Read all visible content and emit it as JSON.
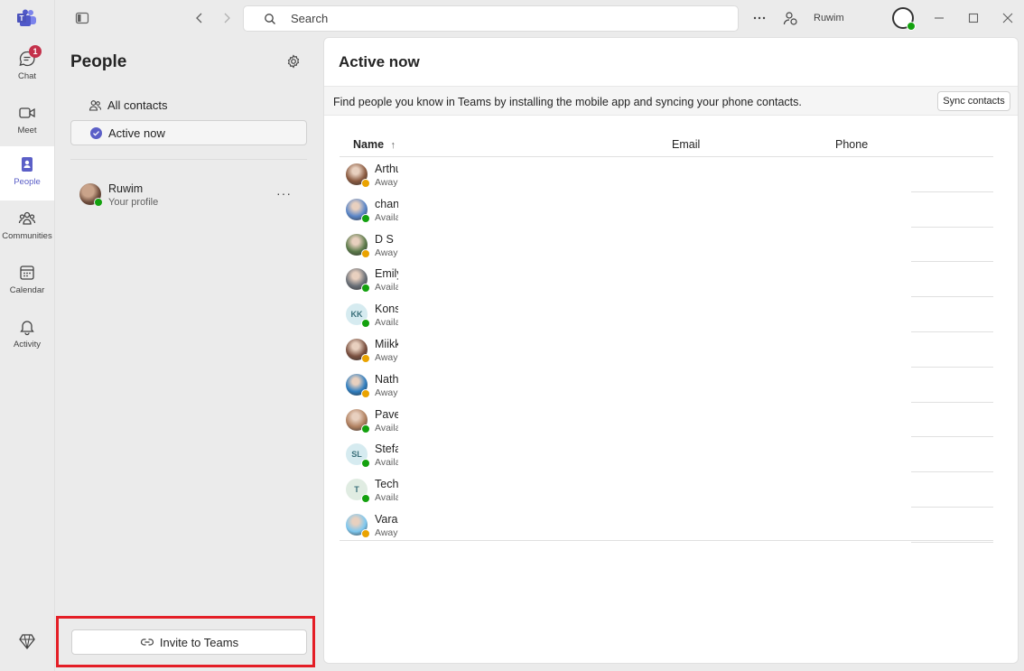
{
  "rail": {
    "items": [
      {
        "label": "Chat",
        "badge": "1"
      },
      {
        "label": "Meet"
      },
      {
        "label": "People"
      },
      {
        "label": "Communities"
      },
      {
        "label": "Calendar"
      },
      {
        "label": "Activity"
      }
    ]
  },
  "titlebar": {
    "search_placeholder": "Search",
    "user_name": "Ruwim"
  },
  "people_panel": {
    "title": "People",
    "nav": [
      "All contacts",
      "Active now"
    ],
    "profile": {
      "name": "Ruwim",
      "subtitle": "Your profile"
    },
    "invite_label": "Invite to Teams"
  },
  "main": {
    "title": "Active now",
    "banner_text": "Find people you know in Teams by installing the mobile app and syncing your phone contacts.",
    "sync_label": "Sync contacts",
    "columns": {
      "name": "Name",
      "name_sort": "↑",
      "email": "Email",
      "phone": "Phone"
    },
    "contacts": [
      {
        "name": "Arthu",
        "status": "Away",
        "avatar": "photo",
        "color": "#8a5a40",
        "state": "away"
      },
      {
        "name": "chan",
        "status": "Availa",
        "avatar": "photo",
        "color": "#5a86c8",
        "state": "available"
      },
      {
        "name": "D S",
        "status": "Away",
        "avatar": "photo",
        "color": "#5b7a4a",
        "state": "away"
      },
      {
        "name": "Emily",
        "status": "Availa",
        "avatar": "photo",
        "color": "#6a7078",
        "state": "available"
      },
      {
        "name": "Kons",
        "status": "Availa",
        "avatar": "KK",
        "color": "#d6ebf0",
        "state": "available"
      },
      {
        "name": "Miikk",
        "status": "Away",
        "avatar": "photo",
        "color": "#7a5040",
        "state": "away"
      },
      {
        "name": "Nath",
        "status": "Away",
        "avatar": "photo",
        "color": "#2f7ec0",
        "state": "away"
      },
      {
        "name": "Pavel",
        "status": "Availa",
        "avatar": "photo",
        "color": "#b08060",
        "state": "available"
      },
      {
        "name": "Stefa",
        "status": "Availa",
        "avatar": "SL",
        "color": "#d6ebf0",
        "state": "available"
      },
      {
        "name": "Techt",
        "status": "Availa",
        "avatar": "T",
        "color": "#e0ece2",
        "state": "available"
      },
      {
        "name": "Varar",
        "status": "Away",
        "avatar": "photo",
        "color": "#7ec8f0",
        "state": "away"
      }
    ]
  },
  "colors": {
    "accent": "#5b5fc7",
    "available": "#13a10e",
    "away": "#eaa300",
    "highlight": "#e41e26"
  }
}
